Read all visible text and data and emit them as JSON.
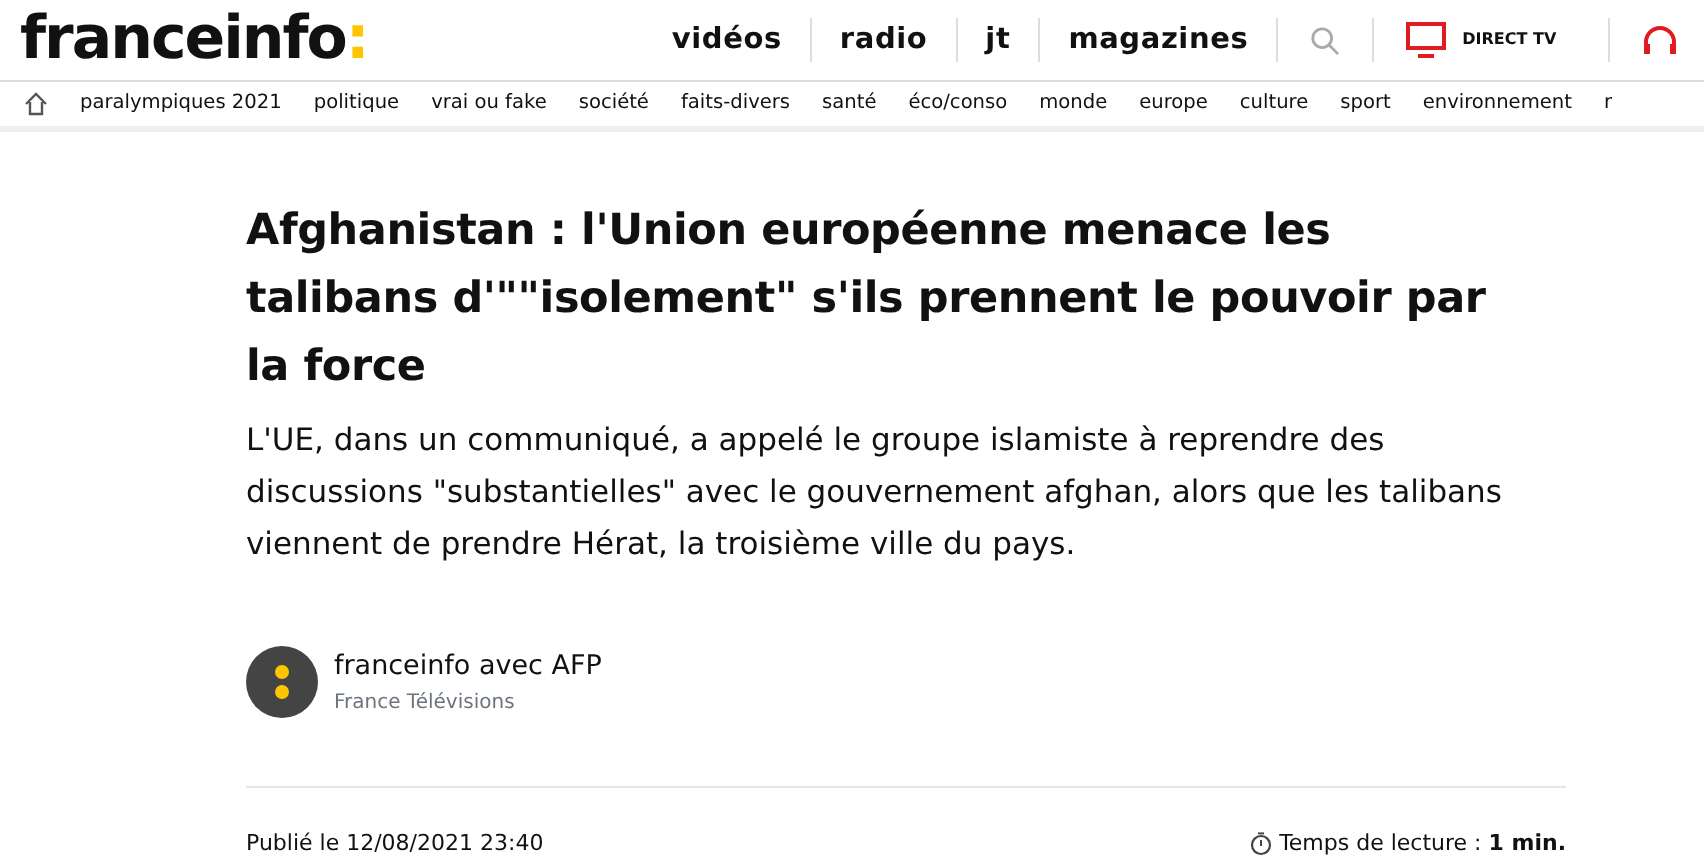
{
  "header": {
    "logo": "franceinfo",
    "logo_mark": ":",
    "links": [
      "vidéos",
      "radio",
      "jt",
      "magazines"
    ],
    "live": "DIRECT TV"
  },
  "nav": [
    "paralympiques 2021",
    "politique",
    "vrai ou fake",
    "société",
    "faits-divers",
    "santé",
    "éco/conso",
    "monde",
    "europe",
    "culture",
    "sport",
    "environnement",
    "r"
  ],
  "article": {
    "title": "Afghanistan : l'Union européenne menace les talibans d'\"\"isolement\" s'ils prennent le pouvoir par la force",
    "lede": "L'UE, dans un communiqué, a appelé le groupe islamiste à reprendre des discussions \"substantielles\" avec le gouvernement afghan, alors que les talibans viennent de prendre Hérat, la troisième ville du pays.",
    "author": "franceinfo avec AFP",
    "author_org": "France Télévisions",
    "published": "Publié le 12/08/2021 23:40",
    "reading_label": "Temps de lecture : ",
    "reading_time": "1 min."
  }
}
